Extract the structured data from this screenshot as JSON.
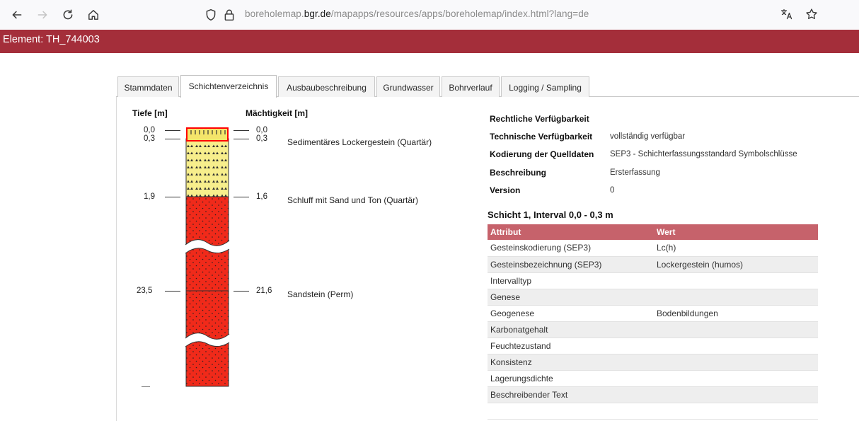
{
  "browser": {
    "url_prefix": "boreholemap.",
    "url_host": "bgr.de",
    "url_path": "/mapapps/resources/apps/boreholemap/index.html?lang=de"
  },
  "titlebar": {
    "title": "Element: TH_744003"
  },
  "tabs": [
    {
      "label": "Stammdaten",
      "active": false
    },
    {
      "label": "Schichtenverzeichnis",
      "active": true
    },
    {
      "label": "Ausbaubeschreibung",
      "active": false
    },
    {
      "label": "Grundwasser",
      "active": false
    },
    {
      "label": "Bohrverlauf",
      "active": false
    },
    {
      "label": "Logging / Sampling",
      "active": false
    }
  ],
  "column": {
    "depth_header": "Tiefe [m]",
    "thickness_header": "Mächtigkeit [m]",
    "depths": [
      "0,0",
      "0,3",
      "1,9",
      "23,5"
    ],
    "thicknesses": [
      "0,0",
      "0,3",
      "1,6",
      "21,6"
    ],
    "layers": [
      {
        "description": "Sedimentäres Lockergestein (Quartär)",
        "color": "#f4e56a"
      },
      {
        "description": "Schluff mit Sand und Ton (Quartär)",
        "color": "#f7ee8c"
      },
      {
        "description": "Sandstein (Perm)",
        "color": "#f02a1a"
      }
    ],
    "highlight_color": "#ff0000"
  },
  "info": {
    "rows": [
      {
        "key": "Rechtliche Verfügbarkeit",
        "value": ""
      },
      {
        "key": "Technische Verfügbarkeit",
        "value": "vollständig verfügbar"
      },
      {
        "key": "Kodierung der Quelldaten",
        "value": "SEP3 - Schichterfassungsstandard Symbolschlüsse"
      },
      {
        "key": "Beschreibung",
        "value": "Ersterfassung"
      },
      {
        "key": "Version",
        "value": "0"
      }
    ]
  },
  "layer_detail": {
    "title": "Schicht 1, Interval 0,0 - 0,3 m",
    "columns": [
      "Attribut",
      "Wert"
    ],
    "rows": [
      [
        "Gesteinskodierung (SEP3)",
        "Lc(h)"
      ],
      [
        "Gesteinsbezeichnung (SEP3)",
        "Lockergestein (humos)"
      ],
      [
        "Intervalltyp",
        ""
      ],
      [
        "Genese",
        ""
      ],
      [
        "Geogenese",
        "Bodenbildungen"
      ],
      [
        "Karbonatgehalt",
        ""
      ],
      [
        "Feuchtezustand",
        ""
      ],
      [
        "Konsistenz",
        ""
      ],
      [
        "Lagerungsdichte",
        ""
      ],
      [
        "Beschreibender Text",
        ""
      ]
    ],
    "header_color": "#c6626b"
  }
}
